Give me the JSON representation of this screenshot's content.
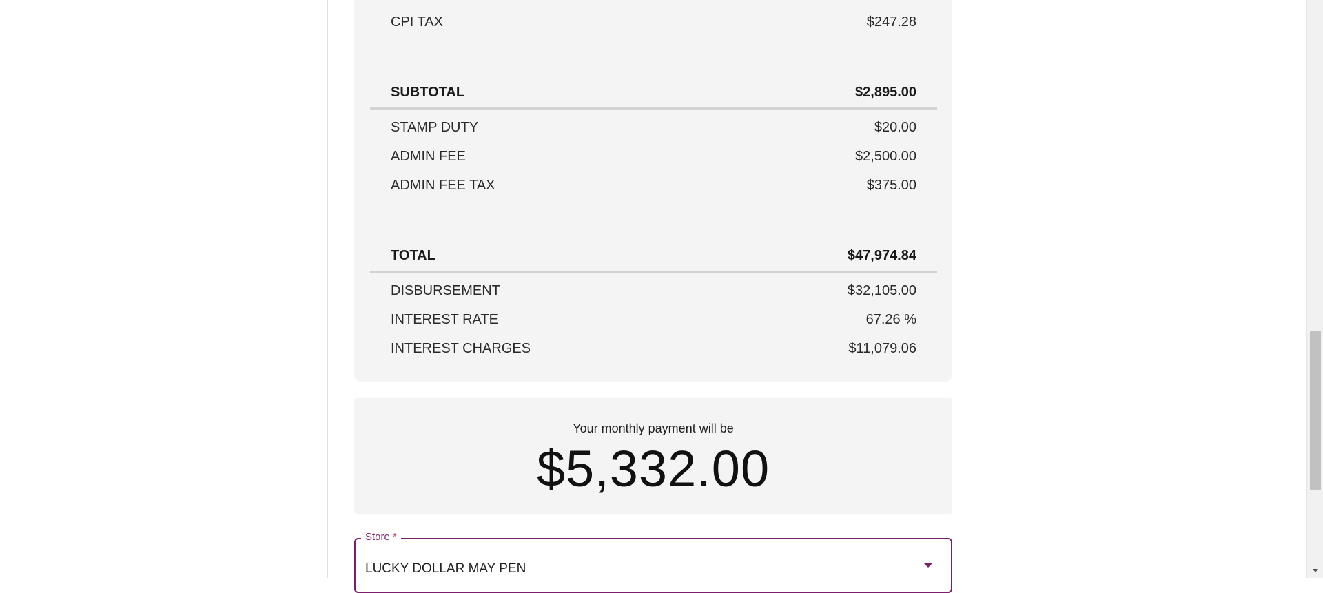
{
  "summary": {
    "cpi_tax": {
      "label": "CPI TAX",
      "value": "$247.28"
    },
    "subtotal": {
      "label": "SUBTOTAL",
      "value": "$2,895.00"
    },
    "stamp_duty": {
      "label": "STAMP DUTY",
      "value": "$20.00"
    },
    "admin_fee": {
      "label": "ADMIN FEE",
      "value": "$2,500.00"
    },
    "admin_fee_tax": {
      "label": "ADMIN FEE TAX",
      "value": "$375.00"
    },
    "total": {
      "label": "TOTAL",
      "value": "$47,974.84"
    },
    "disbursement": {
      "label": "DISBURSEMENT",
      "value": "$32,105.00"
    },
    "interest_rate": {
      "label": "INTEREST RATE",
      "value": "67.26 %"
    },
    "interest_charges": {
      "label": "INTEREST CHARGES",
      "value": "$11,079.06"
    }
  },
  "payment": {
    "caption": "Your monthly payment will be",
    "amount": "$5,332.00"
  },
  "store": {
    "label": "Store",
    "required_marker": "*",
    "value": "LUCKY DOLLAR MAY PEN"
  },
  "colors": {
    "accent": "#7b1f6a",
    "card_background": "#f4f4f4",
    "divider": "#d3d3d3"
  },
  "icons": {
    "dropdown": "caret-down-icon",
    "scroll_down": "scroll-down-arrow-icon"
  }
}
